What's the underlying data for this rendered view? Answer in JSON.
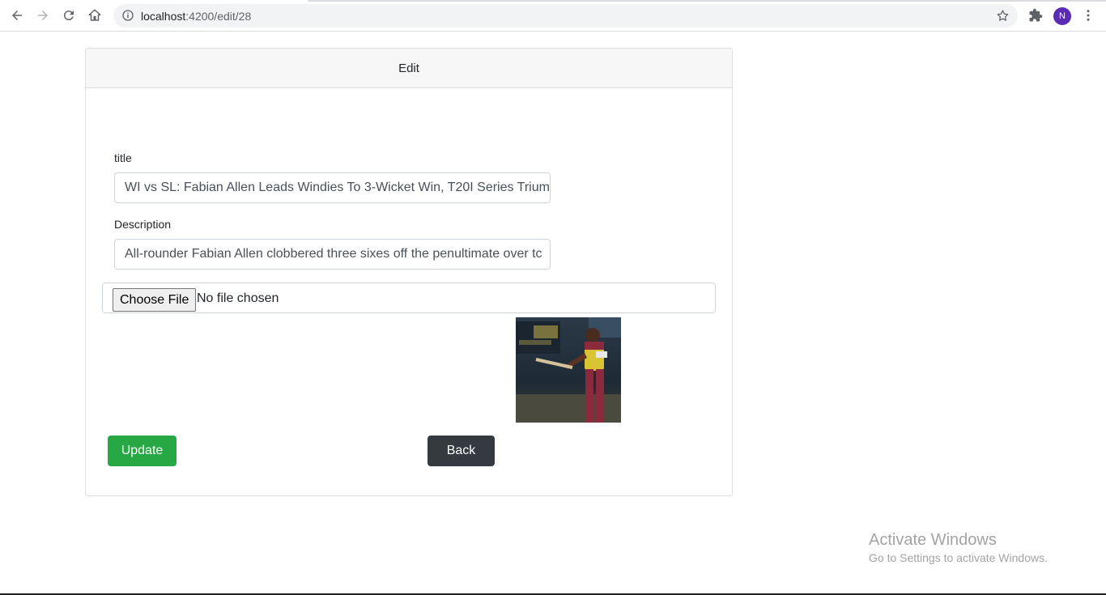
{
  "browser": {
    "url_host": "localhost",
    "url_path": ":4200/edit/28",
    "profile_initial": "N",
    "icons": [
      "back-arrow-icon",
      "forward-arrow-icon",
      "reload-icon",
      "home-icon",
      "info-icon",
      "star-icon",
      "extensions-icon",
      "kebab-menu-icon"
    ]
  },
  "card": {
    "header": "Edit"
  },
  "form": {
    "title_label": "title",
    "title_value": "WI vs SL: Fabian Allen Leads Windies To 3-Wicket Win, T20I Series Trium",
    "description_label": "Description",
    "description_value": "All-rounder Fabian Allen clobbered three sixes off the penultimate over tc",
    "file_button": "Choose File",
    "file_status": "No file chosen",
    "update_label": "Update",
    "back_label": "Back"
  },
  "colors": {
    "update": "#28a745",
    "back": "#343a40",
    "avatar": "#5b2bb5"
  },
  "watermark": {
    "title": "Activate Windows",
    "subtitle": "Go to Settings to activate Windows."
  }
}
